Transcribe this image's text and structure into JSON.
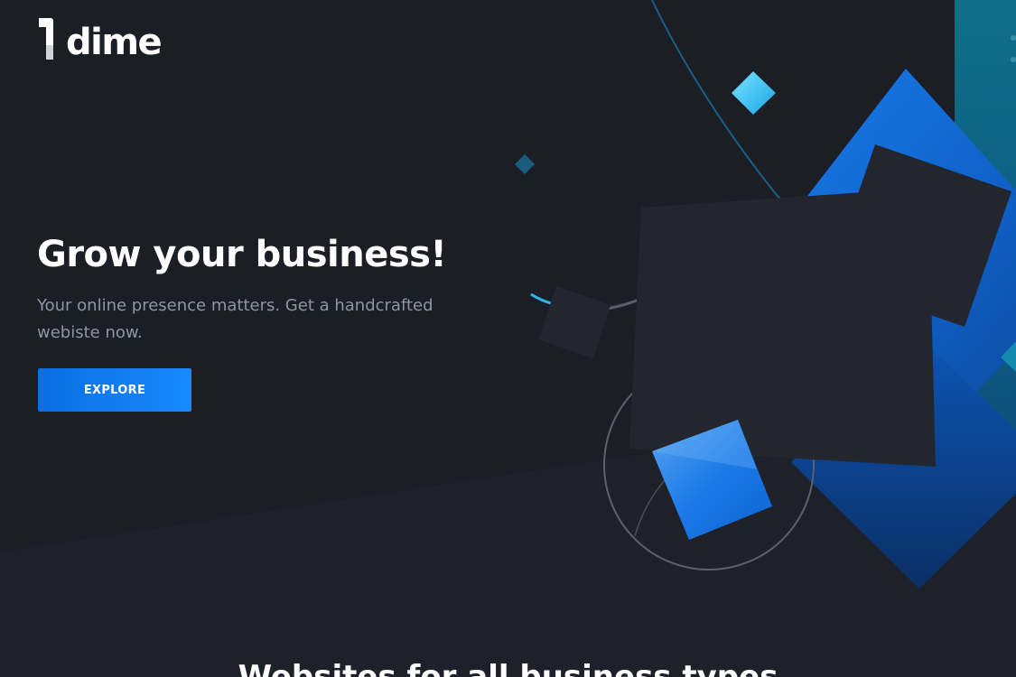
{
  "brand": {
    "name": "dime",
    "logo_icon": "dime-logo-mark"
  },
  "hero": {
    "title": "Grow your business!",
    "subtitle": "Your online presence matters. Get a handcrafted webiste now.",
    "cta_label": "EXPLORE"
  },
  "next_section": {
    "heading": "Websites for all business types"
  },
  "colors": {
    "background": "#1e2029",
    "accent_blue": "#1283f5",
    "accent_cyan": "#29c3f2",
    "dark_square": "#23262f",
    "subtitle_gray": "#8f94a3"
  }
}
